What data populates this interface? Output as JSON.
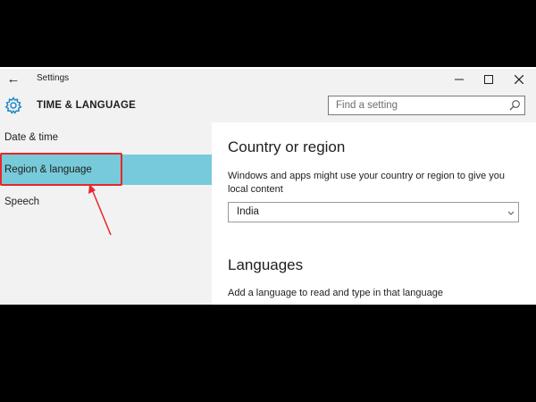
{
  "window": {
    "title": "Settings",
    "back_icon": "back-arrow-icon",
    "controls": [
      "minimize-icon",
      "maximize-icon",
      "close-icon"
    ]
  },
  "header": {
    "icon": "gear-icon",
    "title": "TIME & LANGUAGE",
    "search": {
      "placeholder": "Find a setting",
      "value": "",
      "icon": "search-icon"
    }
  },
  "sidebar": {
    "items": [
      {
        "label": "Date & time",
        "selected": false
      },
      {
        "label": "Region & language",
        "selected": true
      },
      {
        "label": "Speech",
        "selected": false
      }
    ]
  },
  "main": {
    "country": {
      "heading": "Country or region",
      "description": "Windows and apps might use your country or region to give you local content",
      "selected_value": "India"
    },
    "languages": {
      "heading": "Languages",
      "description": "Add a language to read and type in that language"
    }
  },
  "annotation": {
    "highlight_color": "#e8262b",
    "icon": "red-arrow"
  },
  "colors": {
    "accent_selection": "#77cad9",
    "gear_icon": "#1f88c9",
    "background_outside": "#000000"
  }
}
